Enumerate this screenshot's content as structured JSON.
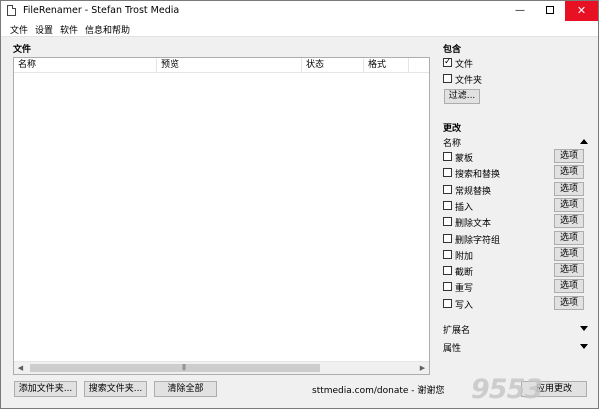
{
  "window": {
    "title": "FileRenamer - Stefan Trost Media",
    "minimize_glyph": "—",
    "close_glyph": "✕"
  },
  "menu": [
    "文件",
    "设置",
    "软件",
    "信息和帮助"
  ],
  "files_section": {
    "label": "文件",
    "columns": [
      "名称",
      "预览",
      "状态",
      "格式"
    ]
  },
  "bottom_buttons": {
    "add_folder": "添加文件夹...",
    "search_folder": "搜索文件夹...",
    "clear_all": "清除全部",
    "apply": "应用更改"
  },
  "donate_text": "sttmedia.com/donate - 谢谢您",
  "include": {
    "label": "包含",
    "files": {
      "label": "文件",
      "checked": true
    },
    "folders": {
      "label": "文件夹",
      "checked": false
    },
    "filter_button": "过滤..."
  },
  "changes": {
    "label": "更改",
    "name_group": "名称",
    "option_label": "选项",
    "items": [
      {
        "label": "蒙板",
        "checked": false
      },
      {
        "label": "搜索和替换",
        "checked": false
      },
      {
        "label": "常规替换",
        "checked": false
      },
      {
        "label": "插入",
        "checked": false
      },
      {
        "label": "删除文本",
        "checked": false
      },
      {
        "label": "删除字符组",
        "checked": false
      },
      {
        "label": "附加",
        "checked": false
      },
      {
        "label": "截断",
        "checked": false
      },
      {
        "label": "重写",
        "checked": false
      },
      {
        "label": "写入",
        "checked": false
      }
    ],
    "extension_group": "扩展名",
    "attributes_group": "属性"
  },
  "watermark": "9553",
  "icons": {
    "check": "✓",
    "scroll_left": "◀",
    "scroll_right": "▶",
    "grip": "|||"
  }
}
